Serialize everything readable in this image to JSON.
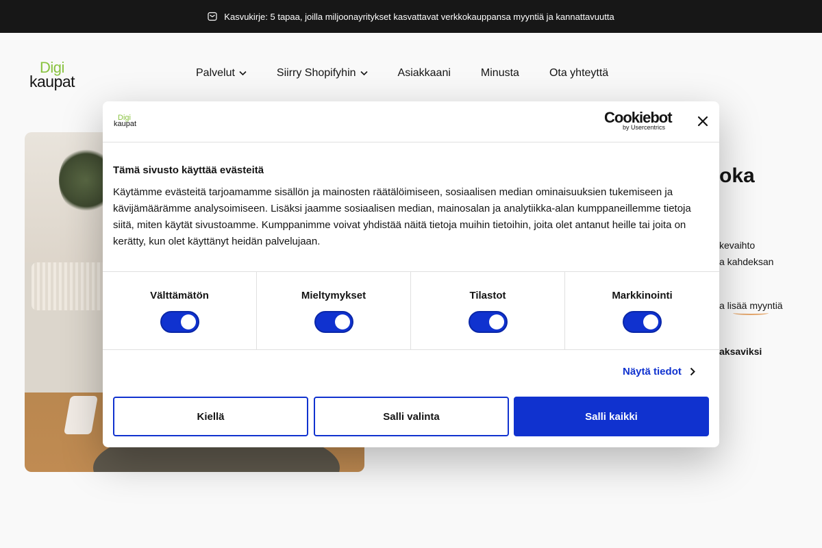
{
  "topbar": {
    "text": "Kasvukirje: 5 tapaa, joilla miljoonayritykset kasvattavat verkkokauppansa myyntiä ja kannattavuutta",
    "icon": "mail-icon"
  },
  "logo": {
    "line1": "Digi",
    "line2": "kaupat"
  },
  "nav": [
    {
      "label": "Palvelut",
      "dropdown": true
    },
    {
      "label": "Siirry Shopifyhin",
      "dropdown": true
    },
    {
      "label": "Asiakkaani",
      "dropdown": false
    },
    {
      "label": "Minusta",
      "dropdown": false
    },
    {
      "label": "Ota yhteyttä",
      "dropdown": false
    }
  ],
  "background_text": {
    "heading_fragment": "oka",
    "p1_line1": "kevaihto",
    "p1_line2": "a kahdeksan",
    "p2": "a lisää myyntiä",
    "p3": "aksaviksi"
  },
  "cookie": {
    "brand_main": "Cookiebot",
    "brand_sub": "by Usercentrics",
    "title": "Tämä sivusto käyttää evästeitä",
    "body": "Käytämme evästeitä tarjoamamme sisällön ja mainosten räätälöimiseen, sosiaalisen median ominaisuuksien tukemiseen ja kävijämäärämme analysoimiseen. Lisäksi jaamme sosiaalisen median, mainosalan ja analytiikka-alan kumppaneillemme tietoja siitä, miten käytät sivustoamme. Kumppanimme voivat yhdistää näitä tietoja muihin tietoihin, joita olet antanut heille tai joita on kerätty, kun olet käyttänyt heidän palvelujaan.",
    "toggles": [
      {
        "label": "Välttämätön",
        "on": true
      },
      {
        "label": "Mieltymykset",
        "on": true
      },
      {
        "label": "Tilastot",
        "on": true
      },
      {
        "label": "Markkinointi",
        "on": true
      }
    ],
    "details_label": "Näytä tiedot",
    "buttons": {
      "deny": "Kiellä",
      "allow_selection": "Salli valinta",
      "allow_all": "Salli kaikki"
    },
    "colors": {
      "accent": "#1032cf",
      "logo_green": "#88c23f"
    }
  }
}
